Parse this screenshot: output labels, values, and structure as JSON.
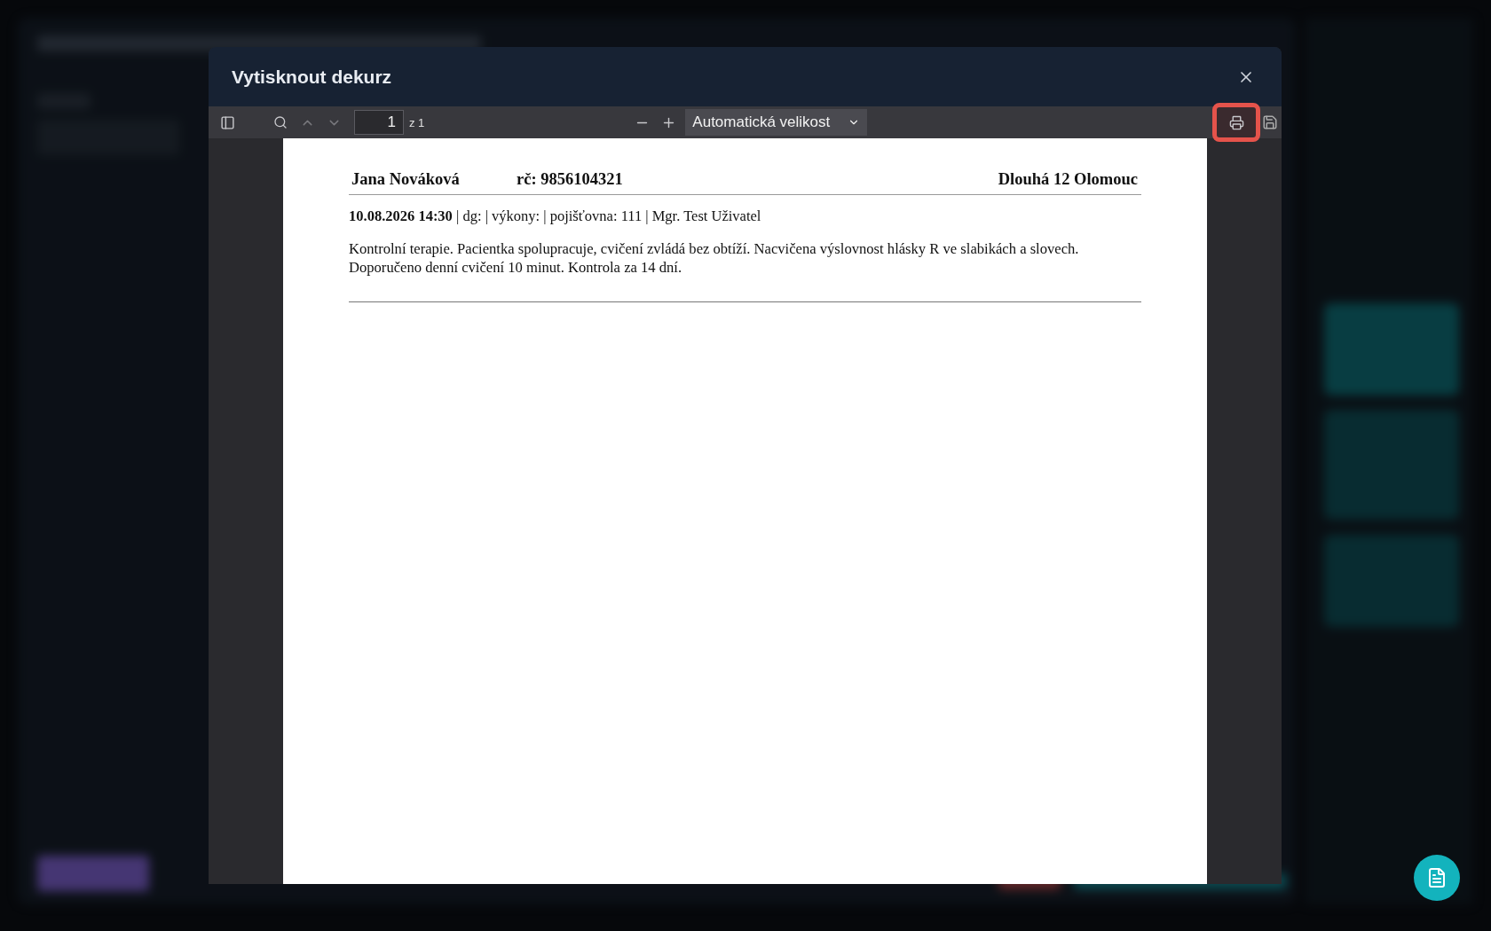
{
  "dialog": {
    "title": "Vytisknout dekurz"
  },
  "toolbar": {
    "page_number": "1",
    "page_count": "z 1",
    "zoom": "Automatická velikost",
    "print_highlighted": true
  },
  "document": {
    "patient_name": "Jana Nováková",
    "birth_number": "rč: 9856104321",
    "address": "Dlouhá 12 Olomouc",
    "meta": "**10.08.2026 14:30** | dg: | výkony: | pojišťovna: 111 | Mgr. Test Uživatel",
    "body": "Kontrolní terapie. Pacientka spolupracuje, cvičení zvládá bez obtíží. Nacvičena výslovnost hlásky R ve slabikách a slovech. Doporučeno denní cvičení 10 minut. Kontrola za 14 dní."
  }
}
